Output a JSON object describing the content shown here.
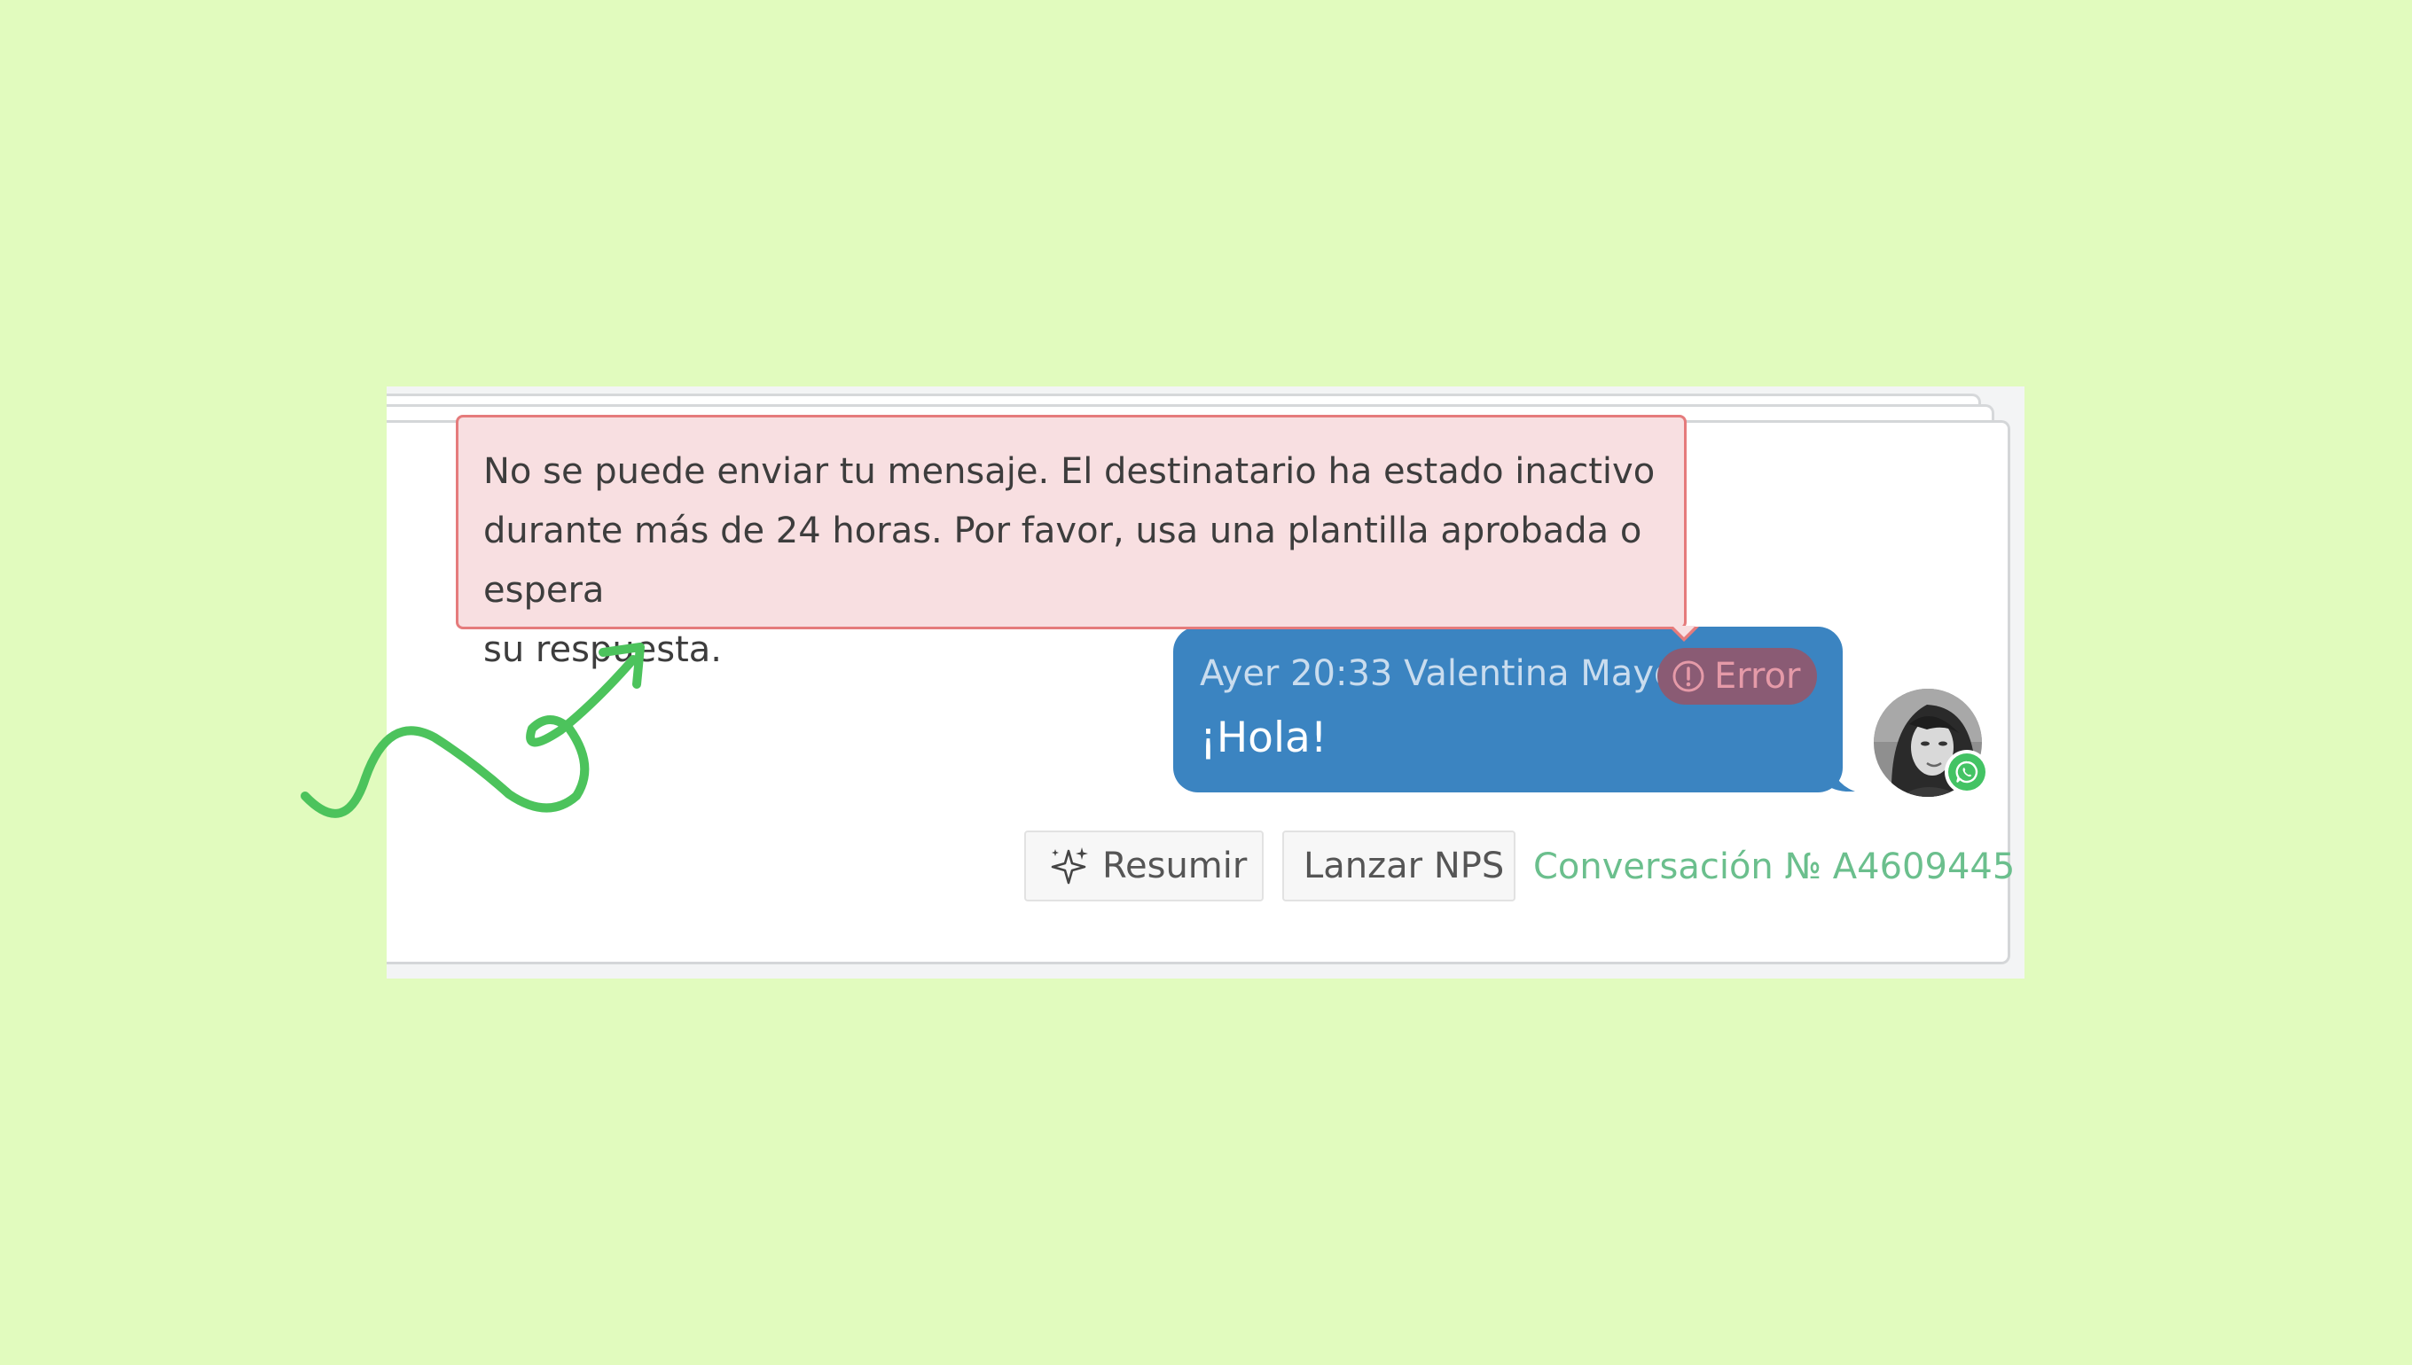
{
  "error_tooltip": {
    "line1": "No se puede enviar tu mensaje. El destinatario ha estado inactivo",
    "line2": "durante más de 24 horas. Por favor, usa una plantilla aprobada o espera",
    "line3": "su respuesta."
  },
  "message": {
    "meta": "Ayer 20:33 Valentina Mayor",
    "status_label": "Error",
    "text": "¡Hola!",
    "channel_icon": "whatsapp-icon",
    "bubble_color": "#3b84c1"
  },
  "actions": {
    "summarize_label": "Resumir",
    "summarize_icon": "sparkles-icon",
    "nps_label": "Lanzar NPS"
  },
  "conversation": {
    "id_label": "Conversación № A4609445"
  },
  "colors": {
    "background": "#e1fbbe",
    "error_border": "#e57b7c",
    "error_fill": "#f8dfe1",
    "link_green": "#6bbf8d",
    "arrow_green": "#4cc35c"
  }
}
